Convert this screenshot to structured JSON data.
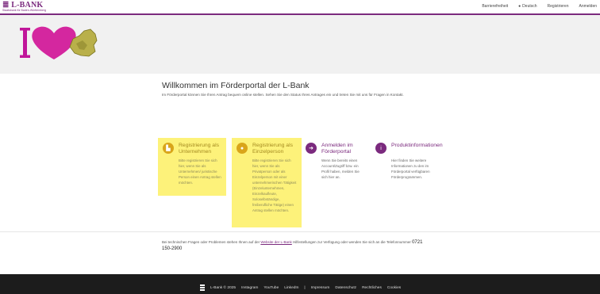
{
  "header": {
    "logo_main": "≣ L-BANK",
    "logo_sub": "Staatsbank für Baden-Württemberg",
    "nav": [
      "Barrierefreiheit",
      "Deutsch",
      "Registrieren",
      "Anmelden"
    ]
  },
  "main": {
    "welcome": "Willkommen im Förderportal der L-Bank",
    "intro": "Im Förderportal können Sie Ihren Antrag bequem online stellen. Sehen Sie den Status Ihres Antrages ein und treten Sie mit uns für Fragen in Kontakt.",
    "tiles": [
      {
        "title": "Registrierung als Unternehmen",
        "desc": "Bitte registrieren Sie sich hier, wenn Sie als Unternehmen/ juristische Person einen Antrag stellen möchten.",
        "icon": "factory-icon"
      },
      {
        "title": "Registrierung als Einzelperson",
        "desc": "Bitte registrieren Sie sich hier, wenn Sie als Privatperson oder als Einzelperson mit einer unternehmerischen Tätigkeit (Einzelunternehmen, Einzelkaufleute, Soloselbständige, freiberufliche Tätige) einen Antrag stellen möchten.",
        "icon": "person-icon"
      },
      {
        "title": "Anmelden im Förderportal",
        "desc": "Wenn Sie bereits einen Account/Zugriff bzw. ein Profil haben, melden Sie sich hier an.",
        "icon": "login-icon"
      },
      {
        "title": "Produktinformationen",
        "desc": "Hier finden Sie weitere Informationen zu den im Förderportal verfügbaren Förderprogrammen.",
        "icon": "info-icon"
      }
    ],
    "note_before": "Bei technischen Fragen oder Problemen stehen Ihnen auf der",
    "note_link": "Website der L-Bank",
    "note_after": "Hilfestellungen zur Verfügung oder wenden Sie sich an die",
    "note_phone_label": "Telefonnummer",
    "note_phone": "0721 150-2900"
  },
  "footer": {
    "copyright": "L-Bank © 2025",
    "links": [
      "Instagram",
      "YouTube",
      "LinkedIn",
      "|",
      "Impressum",
      "Datenschutz",
      "Rechtliches",
      "Cookies"
    ]
  },
  "colors": {
    "brand": "#7b2a7e",
    "tile_yellow": "#fdf27a",
    "footer_bg": "#1c1c1c"
  }
}
